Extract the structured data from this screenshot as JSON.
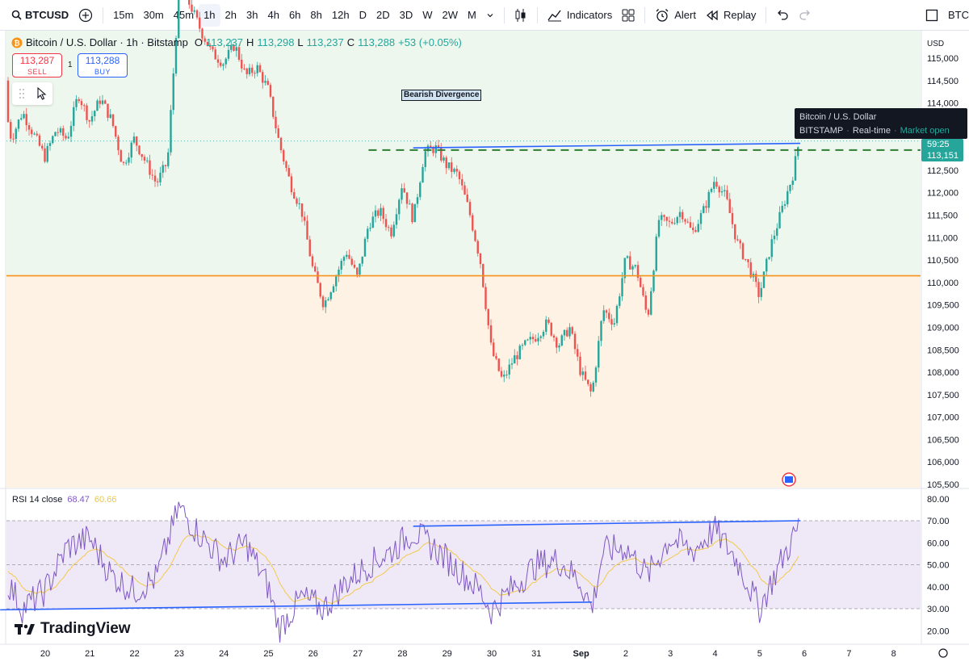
{
  "toolbar": {
    "symbol": "BTCUSD",
    "intervals": [
      "15m",
      "30m",
      "45m",
      "1h",
      "2h",
      "3h",
      "4h",
      "6h",
      "8h",
      "12h",
      "D",
      "2D",
      "3D",
      "W",
      "2W",
      "M"
    ],
    "active_interval": "1h",
    "indicators_label": "Indicators",
    "alert_label": "Alert",
    "replay_label": "Replay",
    "right_label": "BTC"
  },
  "legend": {
    "title": "Bitcoin / U.S. Dollar · 1h · Bitstamp",
    "o_label": "O",
    "o": "113,237",
    "h_label": "H",
    "h": "113,298",
    "l_label": "L",
    "l": "113,237",
    "c_label": "C",
    "c": "113,288",
    "change": "+53 (+0.05%)"
  },
  "trade": {
    "sell_price": "113,287",
    "sell_label": "SELL",
    "buy_price": "113,288",
    "buy_label": "BUY",
    "spread": "1"
  },
  "tooltip": {
    "title": "Bitcoin / U.S. Dollar",
    "exchange": "BITSTAMP",
    "feed": "Real-time",
    "status": "Market open"
  },
  "countdown": {
    "time": "59:25",
    "price": "113,151"
  },
  "rsi_legend": {
    "label": "RSI 14 close",
    "value1": "68.47",
    "value2": "60.66"
  },
  "brand": "TradingView",
  "colors": {
    "up": "#26a69a",
    "down": "#ef5350",
    "orange": "#f7931a",
    "blue": "#2962ff",
    "rsi": "#7e57c2",
    "rsi_ma": "#f2c94c"
  },
  "chart_data": [
    {
      "type": "candlestick",
      "title": "Bitcoin / U.S. Dollar · 1h · Bitstamp",
      "currency": "USD",
      "ylim": [
        105500,
        115300
      ],
      "y_ticks": [
        "115,000",
        "114,500",
        "114,000",
        "113,500",
        "113,000",
        "112,500",
        "112,000",
        "111,500",
        "111,000",
        "110,500",
        "110,000",
        "109,500",
        "109,000",
        "108,500",
        "108,000",
        "107,500",
        "107,000",
        "106,500",
        "106,000",
        "105,500"
      ],
      "x_labels": [
        "20",
        "21",
        "22",
        "23",
        "24",
        "25",
        "26",
        "27",
        "28",
        "29",
        "30",
        "31",
        "Sep",
        "2",
        "3",
        "4",
        "5",
        "6",
        "7",
        "8"
      ],
      "price_path": [
        [
          "19 00:00",
          114500
        ],
        [
          "19 06:00",
          113200
        ],
        [
          "19 12:00",
          113800
        ],
        [
          "19 18:00",
          113300
        ],
        [
          "20 00:00",
          112800
        ],
        [
          "20 06:00",
          113400
        ],
        [
          "20 12:00",
          113200
        ],
        [
          "20 18:00",
          114200
        ],
        [
          "21 00:00",
          113600
        ],
        [
          "21 06:00",
          114100
        ],
        [
          "21 12:00",
          113600
        ],
        [
          "21 18:00",
          112600
        ],
        [
          "22 00:00",
          113200
        ],
        [
          "22 06:00",
          112700
        ],
        [
          "22 12:00",
          112200
        ],
        [
          "22 18:00",
          112700
        ],
        [
          "23 00:00",
          116500
        ],
        [
          "23 06:00",
          116200
        ],
        [
          "23 12:00",
          115600
        ],
        [
          "23 18:00",
          115100
        ],
        [
          "24 00:00",
          114900
        ],
        [
          "24 06:00",
          115300
        ],
        [
          "24 12:00",
          114600
        ],
        [
          "24 18:00",
          114800
        ],
        [
          "25 00:00",
          114300
        ],
        [
          "25 06:00",
          113100
        ],
        [
          "25 12:00",
          112200
        ],
        [
          "25 18:00",
          111600
        ],
        [
          "26 00:00",
          110300
        ],
        [
          "26 06:00",
          109500
        ],
        [
          "26 12:00",
          110100
        ],
        [
          "26 18:00",
          110700
        ],
        [
          "27 00:00",
          110100
        ],
        [
          "27 06:00",
          111300
        ],
        [
          "27 12:00",
          111600
        ],
        [
          "27 18:00",
          111100
        ],
        [
          "28 00:00",
          112200
        ],
        [
          "28 06:00",
          111400
        ],
        [
          "28 12:00",
          112900
        ],
        [
          "28 18:00",
          113000
        ],
        [
          "29 00:00",
          112600
        ],
        [
          "29 06:00",
          112400
        ],
        [
          "29 12:00",
          111600
        ],
        [
          "29 18:00",
          110500
        ],
        [
          "30 00:00",
          108500
        ],
        [
          "30 06:00",
          107800
        ],
        [
          "30 12:00",
          108300
        ],
        [
          "30 18:00",
          108600
        ],
        [
          "31 00:00",
          108800
        ],
        [
          "31 06:00",
          109100
        ],
        [
          "31 12:00",
          108600
        ],
        [
          "31 18:00",
          109000
        ],
        [
          "Sep 1 00:00",
          108000
        ],
        [
          "Sep 1 06:00",
          107500
        ],
        [
          "Sep 1 12:00",
          109400
        ],
        [
          "Sep 1 18:00",
          109100
        ],
        [
          "2 00:00",
          110500
        ],
        [
          "2 06:00",
          110300
        ],
        [
          "2 12:00",
          109200
        ],
        [
          "2 18:00",
          111400
        ],
        [
          "3 00:00",
          111300
        ],
        [
          "3 06:00",
          111600
        ],
        [
          "3 12:00",
          111100
        ],
        [
          "3 18:00",
          111600
        ],
        [
          "4 00:00",
          112300
        ],
        [
          "4 06:00",
          111900
        ],
        [
          "4 12:00",
          110900
        ],
        [
          "4 18:00",
          110400
        ],
        [
          "5 00:00",
          109700
        ],
        [
          "5 06:00",
          110800
        ],
        [
          "5 12:00",
          111600
        ],
        [
          "5 18:00",
          112400
        ],
        [
          "5 22:00",
          113288
        ]
      ],
      "levels": [
        {
          "name": "support-orange",
          "price": 110150,
          "color": "#f7931a"
        },
        {
          "name": "resistance-dashed",
          "price": 112950,
          "color": "#2e7d32"
        }
      ],
      "trendline": [
        [
          "28 06:00",
          113000
        ],
        [
          "5 22:00",
          113100
        ]
      ],
      "annotation": "Bearish Divergence"
    },
    {
      "type": "line",
      "title": "RSI 14 close",
      "ylim": [
        15,
        85
      ],
      "y_ticks": [
        "80.00",
        "70.00",
        "60.00",
        "50.00",
        "40.00",
        "30.00",
        "20.00"
      ],
      "bands": [
        70,
        50,
        30
      ],
      "rsi_path": [
        [
          "19 00:00",
          48
        ],
        [
          "19 12:00",
          30
        ],
        [
          "20 00:00",
          38
        ],
        [
          "20 12:00",
          58
        ],
        [
          "21 00:00",
          62
        ],
        [
          "21 12:00",
          45
        ],
        [
          "22 00:00",
          38
        ],
        [
          "22 12:00",
          44
        ],
        [
          "23 00:00",
          76
        ],
        [
          "23 12:00",
          63
        ],
        [
          "24 00:00",
          52
        ],
        [
          "24 12:00",
          60
        ],
        [
          "25 00:00",
          40
        ],
        [
          "25 06:00",
          21
        ],
        [
          "25 18:00",
          35
        ],
        [
          "26 06:00",
          30
        ],
        [
          "26 18:00",
          42
        ],
        [
          "27 06:00",
          50
        ],
        [
          "27 18:00",
          56
        ],
        [
          "28 06:00",
          65
        ],
        [
          "28 18:00",
          57
        ],
        [
          "29 06:00",
          48
        ],
        [
          "29 18:00",
          38
        ],
        [
          "30 00:00",
          29
        ],
        [
          "30 12:00",
          40
        ],
        [
          "31 00:00",
          50
        ],
        [
          "31 12:00",
          52
        ],
        [
          "Sep 1 00:00",
          42
        ],
        [
          "Sep 1 06:00",
          30
        ],
        [
          "Sep 1 12:00",
          56
        ],
        [
          "2 00:00",
          58
        ],
        [
          "2 12:00",
          45
        ],
        [
          "3 00:00",
          62
        ],
        [
          "3 12:00",
          56
        ],
        [
          "4 00:00",
          66
        ],
        [
          "4 12:00",
          52
        ],
        [
          "5 00:00",
          30
        ],
        [
          "5 12:00",
          52
        ],
        [
          "5 22:00",
          68.47
        ]
      ],
      "rsi_ma_last": 60.66,
      "trendlines": [
        [
          [
            "19 00:00",
            29.5
          ],
          [
            "Sep 1 06:00",
            33
          ]
        ],
        [
          [
            "28 06:00",
            67.5
          ],
          [
            "5 22:00",
            70
          ]
        ]
      ]
    }
  ]
}
